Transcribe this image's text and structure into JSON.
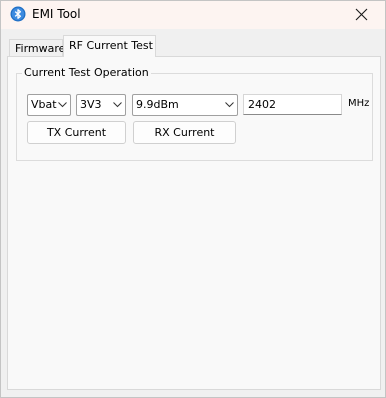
{
  "window": {
    "title": "EMI Tool",
    "icon": "bluetooth-icon"
  },
  "tabs": [
    {
      "label": "Firmware",
      "selected": false
    },
    {
      "label": "RF Current Test",
      "selected": true
    }
  ],
  "current_test": {
    "group_label": "Current Test Operation",
    "power_source": {
      "selected": "Vbat"
    },
    "voltage": {
      "selected": "3V3"
    },
    "tx_power": {
      "selected": "9.9dBm"
    },
    "frequency": {
      "value": "2402",
      "unit": "MHz"
    },
    "tx_current_button": "TX Current",
    "rx_current_button": "RX Current"
  },
  "colors": {
    "title_bar": "#fdf4f1",
    "window_bg": "#f0f0f0",
    "panel_bg": "#f9f9f9",
    "icon_blue": "#1f6fc5"
  }
}
